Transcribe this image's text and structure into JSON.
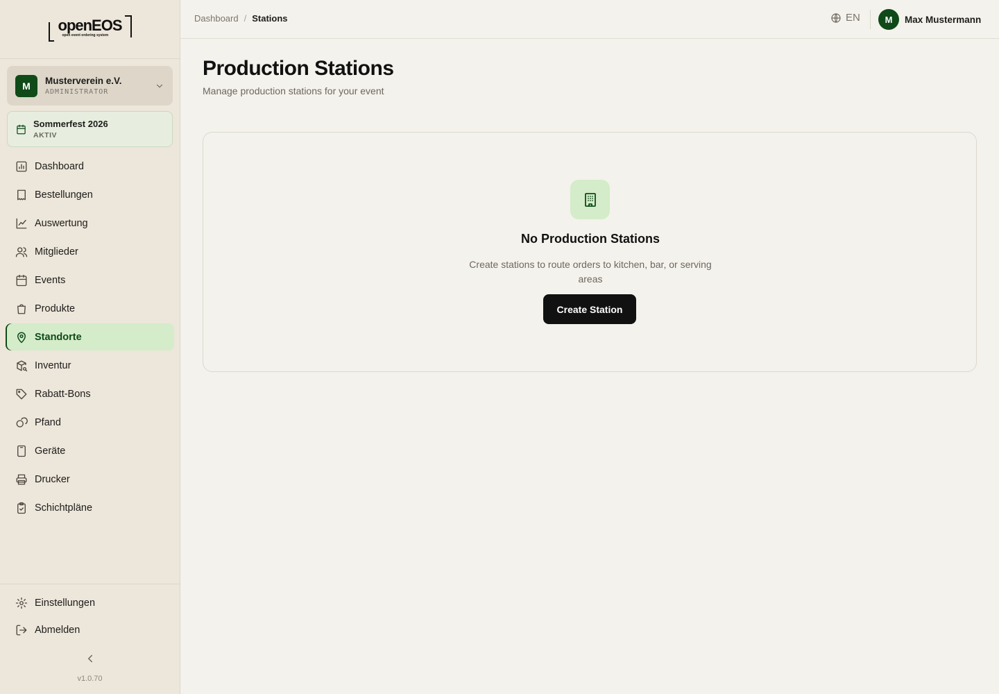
{
  "logo": {
    "word": "openEOS",
    "tagline": "open event ordering system"
  },
  "organization": {
    "initial": "M",
    "name": "Musterverein e.V.",
    "role": "ADMINISTRATOR"
  },
  "event": {
    "name": "Sommerfest 2026",
    "status": "AKTIV"
  },
  "nav": {
    "items": [
      {
        "label": "Dashboard",
        "icon": "dashboard-icon"
      },
      {
        "label": "Bestellungen",
        "icon": "receipt-icon"
      },
      {
        "label": "Auswertung",
        "icon": "chart-line-icon"
      },
      {
        "label": "Mitglieder",
        "icon": "users-icon"
      },
      {
        "label": "Events",
        "icon": "calendar-icon"
      },
      {
        "label": "Produkte",
        "icon": "shopping-bag-icon"
      },
      {
        "label": "Standorte",
        "icon": "map-pin-icon",
        "active": true
      },
      {
        "label": "Inventur",
        "icon": "package-search-icon"
      },
      {
        "label": "Rabatt-Bons",
        "icon": "tag-icon"
      },
      {
        "label": "Pfand",
        "icon": "coins-icon"
      },
      {
        "label": "Geräte",
        "icon": "tablet-icon"
      },
      {
        "label": "Drucker",
        "icon": "printer-icon"
      },
      {
        "label": "Schichtpläne",
        "icon": "clipboard-check-icon"
      }
    ]
  },
  "sidebar_bottom": {
    "settings": "Einstellungen",
    "logout": "Abmelden",
    "version": "v1.0.70"
  },
  "breadcrumb": {
    "root": "Dashboard",
    "separator": "/",
    "current": "Stations"
  },
  "language": "EN",
  "user": {
    "initial": "M",
    "name": "Max Mustermann"
  },
  "page": {
    "title": "Production Stations",
    "subtitle": "Manage production stations for your event"
  },
  "empty_state": {
    "title": "No Production Stations",
    "description": "Create stations to route orders to kitchen, bar, or serving areas",
    "button": "Create Station",
    "icon": "building-icon"
  },
  "colors": {
    "brand": "#0f4a18",
    "active_bg": "#d4ecc9",
    "sidebar_bg": "#ede6da",
    "page_bg": "#f4f2ec"
  }
}
